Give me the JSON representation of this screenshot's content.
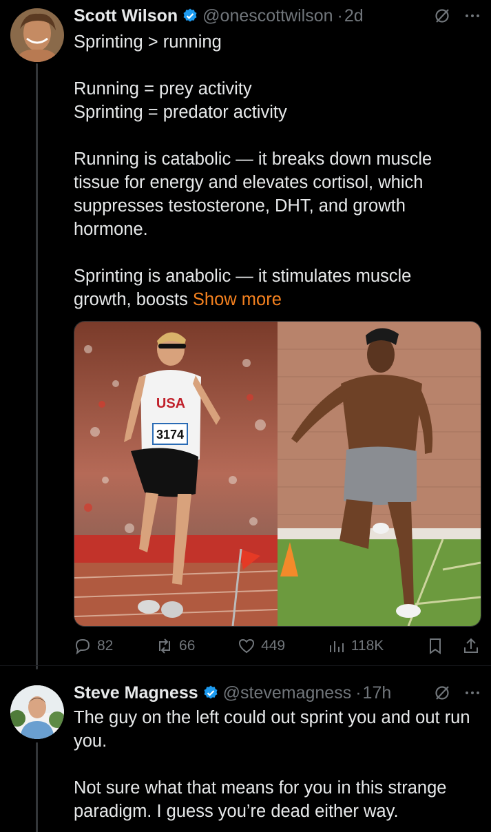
{
  "tweet1": {
    "name": "Scott Wilson",
    "handle": "@onescottwilson",
    "time": "2d",
    "text": "Sprinting > running\n\nRunning = prey activity\nSprinting = predator activity\n\nRunning is catabolic — it breaks down muscle tissue for energy and elevates cortisol, which suppresses testosterone, DHT, and growth hormone.\n\nSprinting is anabolic — it stimulates muscle growth, boosts ",
    "show_more": "Show more",
    "image_text": {
      "jersey_country": "USA",
      "bib_number": "3174"
    },
    "stats": {
      "replies": "82",
      "reposts": "66",
      "likes": "449",
      "views": "118K"
    }
  },
  "tweet2": {
    "name": "Steve Magness",
    "handle": "@stevemagness",
    "time": "17h",
    "text": "The guy on the left could out sprint you and out run you.\n\nNot sure what that means for you in this strange paradigm. I guess you’re dead either way."
  },
  "colors": {
    "background": "#000000",
    "text": "#e7e9ea",
    "muted": "#71767b",
    "verified": "#1d9bf0",
    "show_more": "#f4811f"
  },
  "icons": [
    "verified-badge-icon",
    "grok-icon",
    "more-icon",
    "reply-icon",
    "repost-icon",
    "like-icon",
    "views-icon",
    "bookmark-icon",
    "share-icon"
  ]
}
